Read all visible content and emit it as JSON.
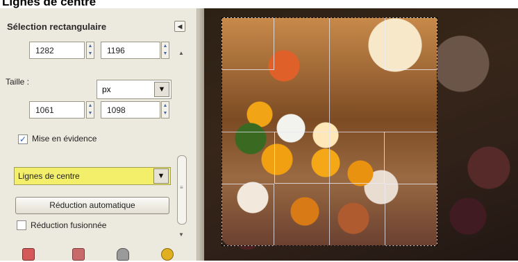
{
  "caption": "Lignes de centre",
  "panel": {
    "section_title": "Sélection rectangulaire",
    "position": {
      "x": "1282",
      "y": "1196"
    },
    "size_label": "Taille :",
    "size_unit": "px",
    "size": {
      "width": "1061",
      "height": "1098"
    },
    "highlight_label": "Mise en évidence",
    "guides_value": "Lignes de centre",
    "auto_shrink_label": "Réduction automatique",
    "merged_shrink_label": "Réduction fusionnée"
  },
  "icons": {
    "collapse": "left-arrow-icon",
    "bottom": [
      "save-preset-icon",
      "restore-preset-icon",
      "delete-preset-icon",
      "reset-icon"
    ]
  },
  "colors": {
    "guides_highlight": "#f3ef6a",
    "panel_bg": "#ece9df",
    "check_accent": "#2b63b8"
  }
}
